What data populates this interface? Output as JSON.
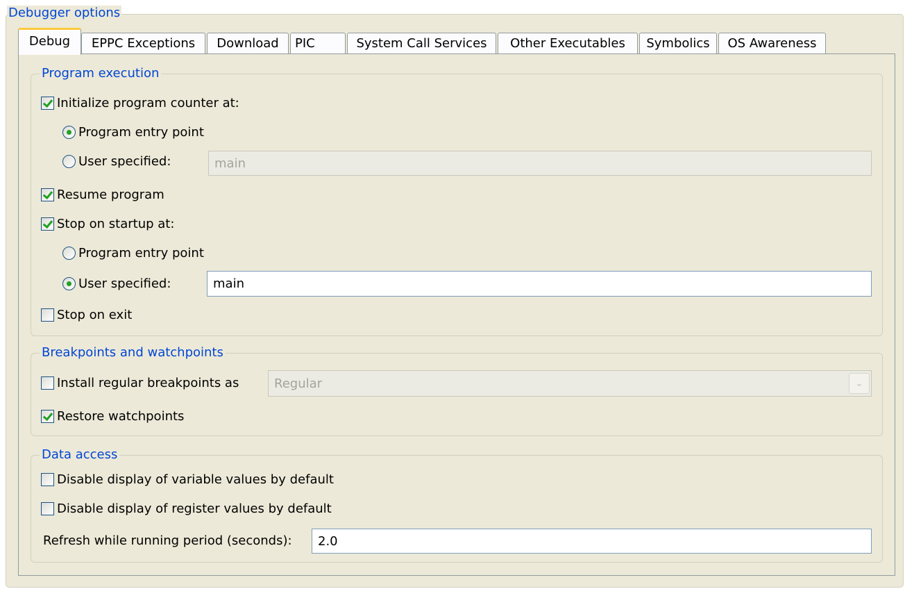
{
  "debugger_options": {
    "title": "Debugger options"
  },
  "tabs": [
    {
      "label": "Debug",
      "active": true
    },
    {
      "label": "EPPC Exceptions",
      "active": false
    },
    {
      "label": "Download",
      "active": false
    },
    {
      "label": "PIC",
      "active": false
    },
    {
      "label": "System Call Services",
      "active": false
    },
    {
      "label": "Other Executables",
      "active": false
    },
    {
      "label": "Symbolics",
      "active": false
    },
    {
      "label": "OS Awareness",
      "active": false
    }
  ],
  "program_execution": {
    "title": "Program execution",
    "init_pc": {
      "label": "Initialize program counter at:",
      "checked": true
    },
    "init_entry": {
      "label": "Program entry point",
      "selected": true
    },
    "init_user": {
      "label": "User specified:",
      "selected": false,
      "value": "main"
    },
    "resume": {
      "label": "Resume program",
      "checked": true
    },
    "stop_startup": {
      "label": "Stop on startup at:",
      "checked": true
    },
    "stop_entry": {
      "label": "Program entry point",
      "selected": false
    },
    "stop_user": {
      "label": "User specified:",
      "selected": true,
      "value": "main"
    },
    "stop_exit": {
      "label": "Stop on exit",
      "checked": false
    }
  },
  "breakpoints": {
    "title": "Breakpoints and watchpoints",
    "install": {
      "label": "Install regular breakpoints as",
      "checked": false,
      "value": "Regular"
    },
    "restore": {
      "label": "Restore watchpoints",
      "checked": true
    }
  },
  "data_access": {
    "title": "Data access",
    "disable_vars": {
      "label": "Disable display of variable values by default",
      "checked": false
    },
    "disable_regs": {
      "label": "Disable display of register values by default",
      "checked": false
    },
    "refresh": {
      "label": "Refresh while running period (seconds):",
      "value": "2.0"
    }
  },
  "colors": {
    "group_title": "#0046d5",
    "tab_highlight": "#ffc83c",
    "check": "#21a121",
    "panel_bg": "#ece9d8"
  }
}
